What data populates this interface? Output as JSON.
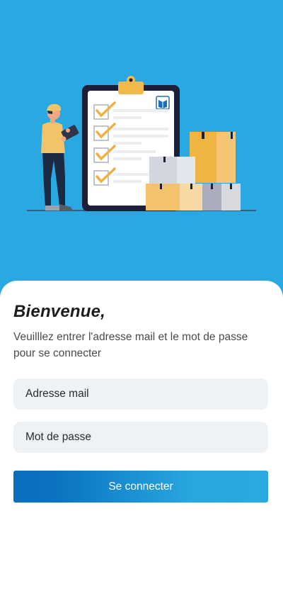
{
  "colors": {
    "background": "#29a8e2",
    "card": "#ffffff",
    "field_bg": "#eff2f4",
    "button_start": "#086fbf",
    "button_end": "#2aa8e0"
  },
  "illustration": {
    "name": "delivery-checklist-illustration"
  },
  "login": {
    "title": "Bienvenue,",
    "subtitle": "Veuilllez entrer l'adresse mail et le mot de passe pour se connecter",
    "email_placeholder": "Adresse mail",
    "password_placeholder": "Mot de passe",
    "submit_label": "Se connecter"
  }
}
